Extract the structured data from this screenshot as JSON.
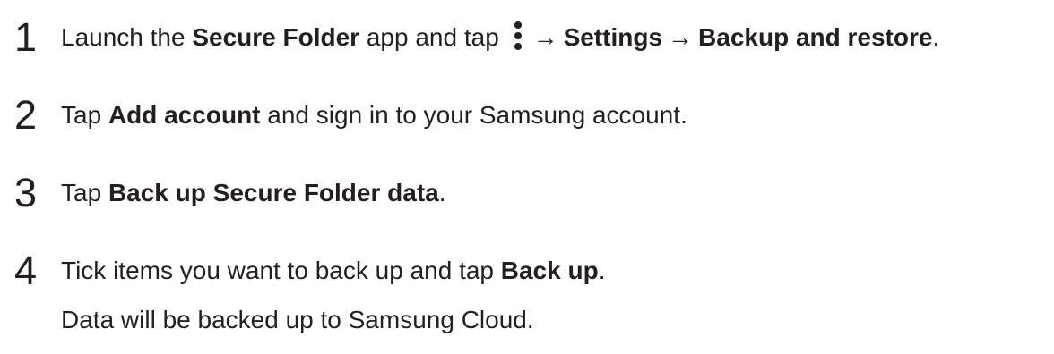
{
  "steps": [
    {
      "number": "1",
      "t1": "Launch the ",
      "b1": "Secure Folder",
      "t2": " app and tap ",
      "icon": "more-options-vertical-dots-icon",
      "arrow1": "→",
      "b2": "Settings",
      "arrow2": "→",
      "b3": "Backup and restore",
      "t3": "."
    },
    {
      "number": "2",
      "t1": "Tap ",
      "b1": "Add account",
      "t2": " and sign in to your Samsung account."
    },
    {
      "number": "3",
      "t1": "Tap ",
      "b1": "Back up Secure Folder data",
      "t2": "."
    },
    {
      "number": "4",
      "t1": "Tick items you want to back up and tap ",
      "b1": "Back up",
      "t2": ".",
      "note": "Data will be backed up to Samsung Cloud."
    }
  ]
}
